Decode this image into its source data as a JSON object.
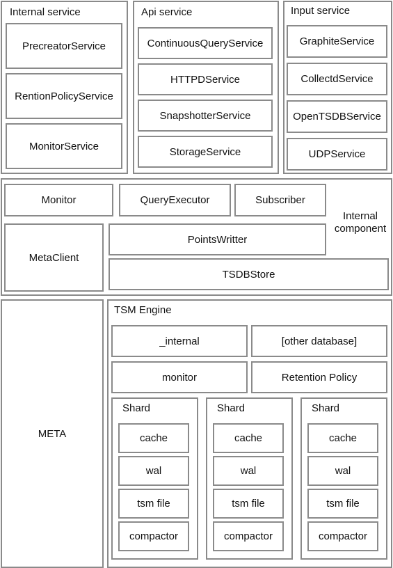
{
  "internal_service": {
    "title": "Internal service",
    "items": [
      "PrecreatorService",
      "RentionPolicyService",
      "MonitorService"
    ]
  },
  "api_service": {
    "title": "Api service",
    "items": [
      "ContinuousQueryService",
      "HTTPDService",
      "SnapshotterService",
      "StorageService"
    ]
  },
  "input_service": {
    "title": "Input service",
    "items": [
      "GraphiteService",
      "CollectdService",
      "OpenTSDBService",
      "UDPService"
    ]
  },
  "internal_component": {
    "title": "Internal component",
    "items": [
      "Monitor",
      "QueryExecutor",
      "Subscriber",
      "MetaClient",
      "PointsWritter",
      "TSDBStore"
    ]
  },
  "meta": {
    "title": "META"
  },
  "tsm_engine": {
    "title": "TSM Engine",
    "databases": [
      "_internal",
      "[other database]",
      "monitor",
      "Retention Policy"
    ],
    "shards": [
      {
        "title": "Shard",
        "items": [
          "cache",
          "wal",
          "tsm file",
          "compactor"
        ]
      },
      {
        "title": "Shard",
        "items": [
          "cache",
          "wal",
          "tsm file",
          "compactor"
        ]
      },
      {
        "title": "Shard",
        "items": [
          "cache",
          "wal",
          "tsm file",
          "compactor"
        ]
      }
    ]
  },
  "colors": {
    "border": "#8a8a8a",
    "background": "#ffffff",
    "text": "#111111"
  }
}
